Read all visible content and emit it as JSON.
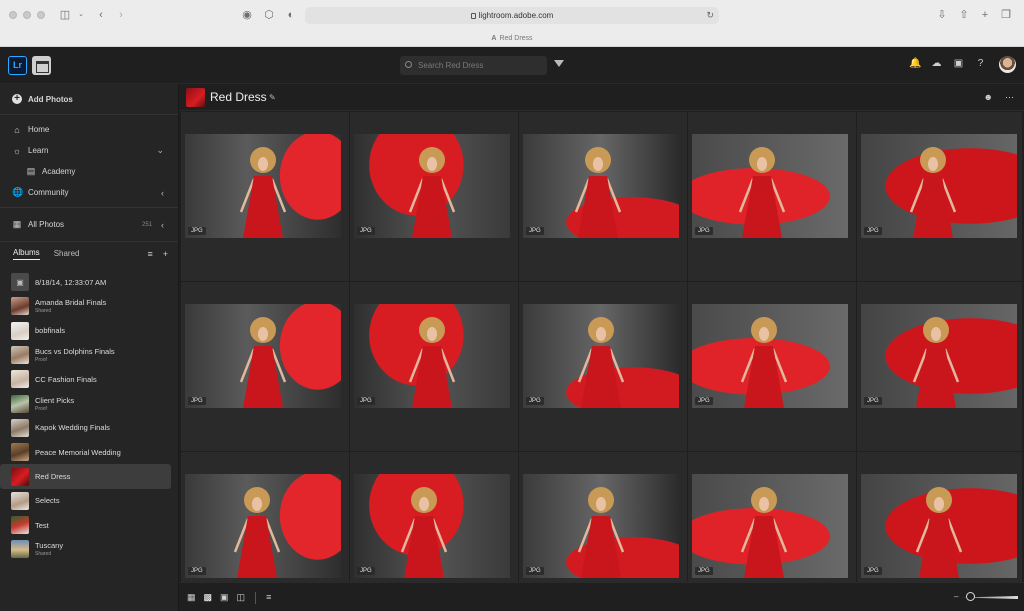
{
  "browser": {
    "url": "lightroom.adobe.com",
    "tab_title": "Red Dress"
  },
  "topbar": {
    "logo": "Lr",
    "search_placeholder": "Search Red Dress"
  },
  "sidebar": {
    "add_photos": "Add Photos",
    "nav": [
      {
        "label": "Home",
        "icon": "home-icon"
      },
      {
        "label": "Learn",
        "icon": "lightbulb-icon"
      },
      {
        "label": "Academy",
        "icon": "books-icon"
      },
      {
        "label": "Community",
        "icon": "globe-icon"
      }
    ],
    "all_photos": {
      "label": "All Photos",
      "count": "251"
    },
    "tabs": [
      "Albums",
      "Shared"
    ],
    "albums": [
      {
        "name": "8/18/14, 12:33:07 AM",
        "sub": ""
      },
      {
        "name": "Amanda Bridal Finals",
        "sub": "Shared"
      },
      {
        "name": "bobfinals",
        "sub": ""
      },
      {
        "name": "Bucs vs Dolphins Finals",
        "sub": "Proof"
      },
      {
        "name": "CC Fashion Finals",
        "sub": ""
      },
      {
        "name": "Client Picks",
        "sub": "Proof"
      },
      {
        "name": "Kapok Wedding Finals",
        "sub": ""
      },
      {
        "name": "Peace Memorial Wedding",
        "sub": ""
      },
      {
        "name": "Red Dress",
        "sub": ""
      },
      {
        "name": "Selects",
        "sub": ""
      },
      {
        "name": "Test",
        "sub": ""
      },
      {
        "name": "Tuscany",
        "sub": "Shared"
      }
    ]
  },
  "main": {
    "title": "Red Dress",
    "photos": [
      {
        "badge": "JPG"
      },
      {
        "badge": "JPG"
      },
      {
        "badge": "JPG"
      },
      {
        "badge": "JPG"
      },
      {
        "badge": "JPG"
      },
      {
        "badge": "JPG"
      },
      {
        "badge": "JPG"
      },
      {
        "badge": "JPG"
      },
      {
        "badge": "JPG"
      },
      {
        "badge": "JPG"
      },
      {
        "badge": "JPG"
      },
      {
        "badge": "JPG"
      },
      {
        "badge": "JPG"
      },
      {
        "badge": "JPG"
      },
      {
        "badge": "JPG"
      }
    ]
  },
  "colors": {
    "accent": "#31a8ff",
    "dress_red": "#c8161c",
    "app_bg": "#1f1f1f"
  }
}
